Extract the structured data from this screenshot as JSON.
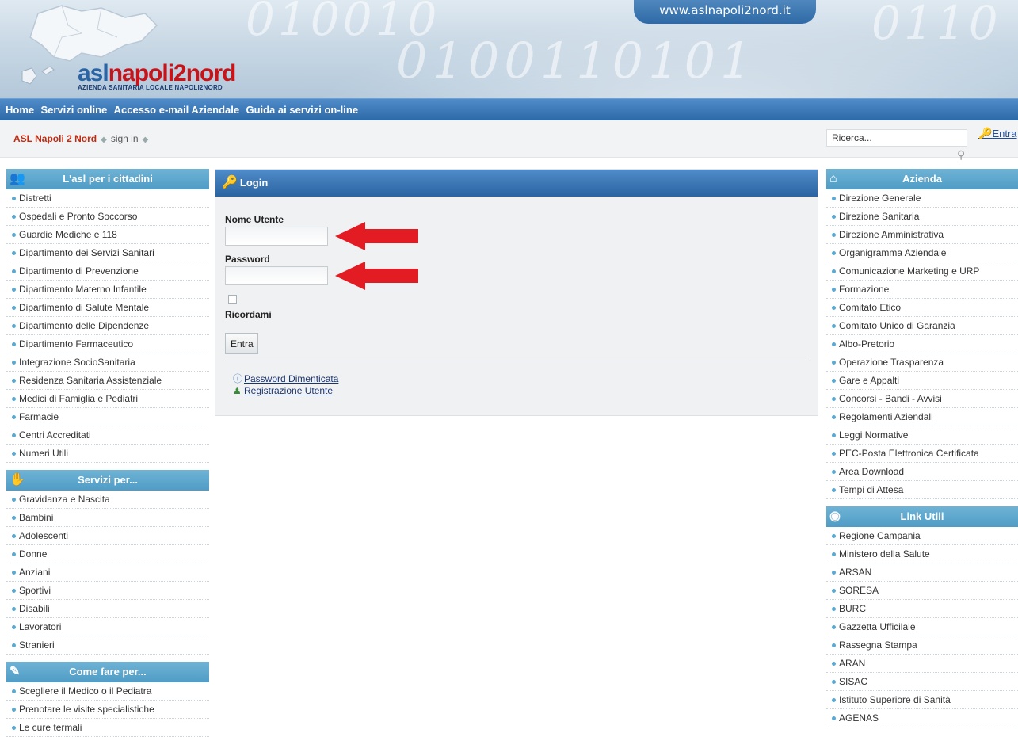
{
  "site": {
    "url_tab": "www.aslnapoli2nord.it",
    "logo_main_1": "asl",
    "logo_main_2": "napoli2nord",
    "logo_sub": "AZIENDA SANITARIA LOCALE NAPOLI2NORD"
  },
  "nav": [
    "Home",
    "Servizi online",
    "Accesso e-mail Aziendale",
    "Guida ai servizi on-line"
  ],
  "breadcrumb": {
    "home": "ASL Napoli 2 Nord",
    "current": "sign in"
  },
  "search": {
    "value": "Ricerca...",
    "button": "Entra"
  },
  "left_boxes": [
    {
      "title": "L'asl per i cittadini",
      "icon": "people-icon",
      "items": [
        "Distretti",
        "Ospedali e Pronto Soccorso",
        "Guardie Mediche e 118",
        "Dipartimento dei Servizi Sanitari",
        "Dipartimento di Prevenzione",
        "Dipartimento Materno Infantile",
        "Dipartimento di Salute Mentale",
        "Dipartimento delle Dipendenze",
        "Dipartimento Farmaceutico",
        "Integrazione SocioSanitaria",
        "Residenza Sanitaria Assistenziale",
        "Medici di Famiglia e Pediatri",
        "Farmacie",
        "Centri Accreditati",
        "Numeri Utili"
      ]
    },
    {
      "title": "Servizi per...",
      "icon": "hand-icon",
      "items": [
        "Gravidanza e Nascita",
        "Bambini",
        "Adolescenti",
        "Donne",
        "Anziani",
        "Sportivi",
        "Disabili",
        "Lavoratori",
        "Stranieri"
      ]
    },
    {
      "title": "Come fare per...",
      "icon": "pencil-icon",
      "items": [
        "Scegliere il Medico o il Pediatra",
        "Prenotare le visite specialistiche",
        "Le cure termali"
      ]
    }
  ],
  "right_boxes": [
    {
      "title": "Azienda",
      "icon": "home-icon",
      "items": [
        "Direzione Generale",
        "Direzione Sanitaria",
        "Direzione Amministrativa",
        "Organigramma Aziendale",
        "Comunicazione Marketing e URP",
        "Formazione",
        "Comitato Etico",
        "Comitato Unico di Garanzia",
        "Albo-Pretorio",
        "Operazione Trasparenza",
        "Gare e Appalti",
        "Concorsi - Bandi - Avvisi",
        "Regolamenti Aziendali",
        "Leggi Normative",
        "PEC-Posta Elettronica Certificata",
        "Area Download",
        "Tempi di Attesa"
      ]
    },
    {
      "title": "Link Utili",
      "icon": "globe-icon",
      "items": [
        "Regione Campania",
        "Ministero della Salute",
        "ARSAN",
        "SORESA",
        "BURC",
        "Gazzetta Ufficilale",
        "Rassegna Stampa",
        "ARAN",
        "SISAC",
        "Istituto Superiore di Sanità",
        "AGENAS"
      ]
    }
  ],
  "login": {
    "title": "Login",
    "username_label": "Nome Utente",
    "username_value": "",
    "password_label": "Password",
    "password_value": "",
    "remember_label": "Ricordami",
    "remember_checked": false,
    "submit": "Entra",
    "forgot_link": "Password Dimenticata",
    "register_link": "Registrazione Utente"
  },
  "colors": {
    "annotation_arrow": "#e31b23",
    "header_bar": "#3b77b6",
    "box_header": "#5aa7cf",
    "breadcrumb_home": "#c52a10"
  }
}
